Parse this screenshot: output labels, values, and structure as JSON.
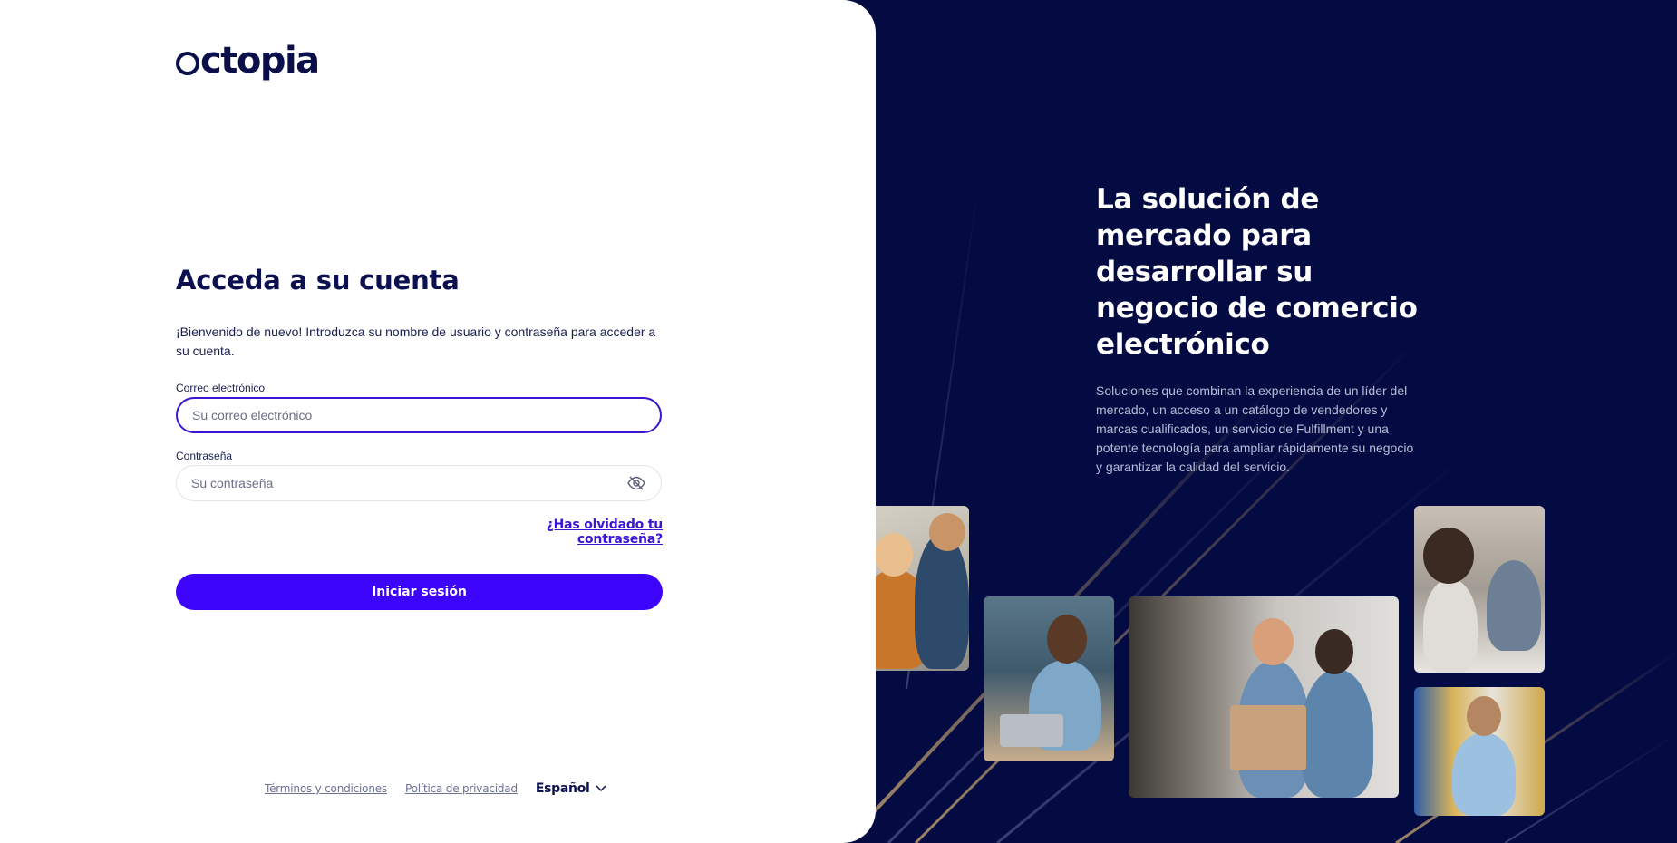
{
  "brand": {
    "logo_text": "ctopia",
    "logo_full": "octopia"
  },
  "login": {
    "title": "Acceda a su cuenta",
    "intro": "¡Bienvenido de nuevo! Introduzca su nombre de usuario y contraseña para acceder a su cuenta.",
    "email": {
      "label": "Correo electrónico",
      "placeholder": "Su correo electrónico",
      "value": ""
    },
    "password": {
      "label": "Contraseña",
      "placeholder": "Su contraseña",
      "value": ""
    },
    "forgot_password": "¿Has olvidado tu contraseña?",
    "submit": "Iniciar sesión"
  },
  "footer": {
    "terms": "Términos y condiciones",
    "privacy": "Política de privacidad",
    "language": "Español"
  },
  "hero": {
    "title": "La solución de mercado para desarrollar su negocio de comercio electrónico",
    "text": "Soluciones que combinan la experiencia de un líder del mercado, un acceso a un catálogo de vendedores y marcas cualificados, un servicio de Fulfillment y una potente tecnología para ampliar rápidamente su negocio y garantizar la calidad del servicio."
  },
  "colors": {
    "accent": "#3d04fc",
    "navy": "#040b43",
    "title": "#0b1050",
    "focus_border": "#3b14d4"
  },
  "icons": {
    "password_toggle": "eye-off-icon",
    "language_dropdown": "chevron-down-icon"
  }
}
